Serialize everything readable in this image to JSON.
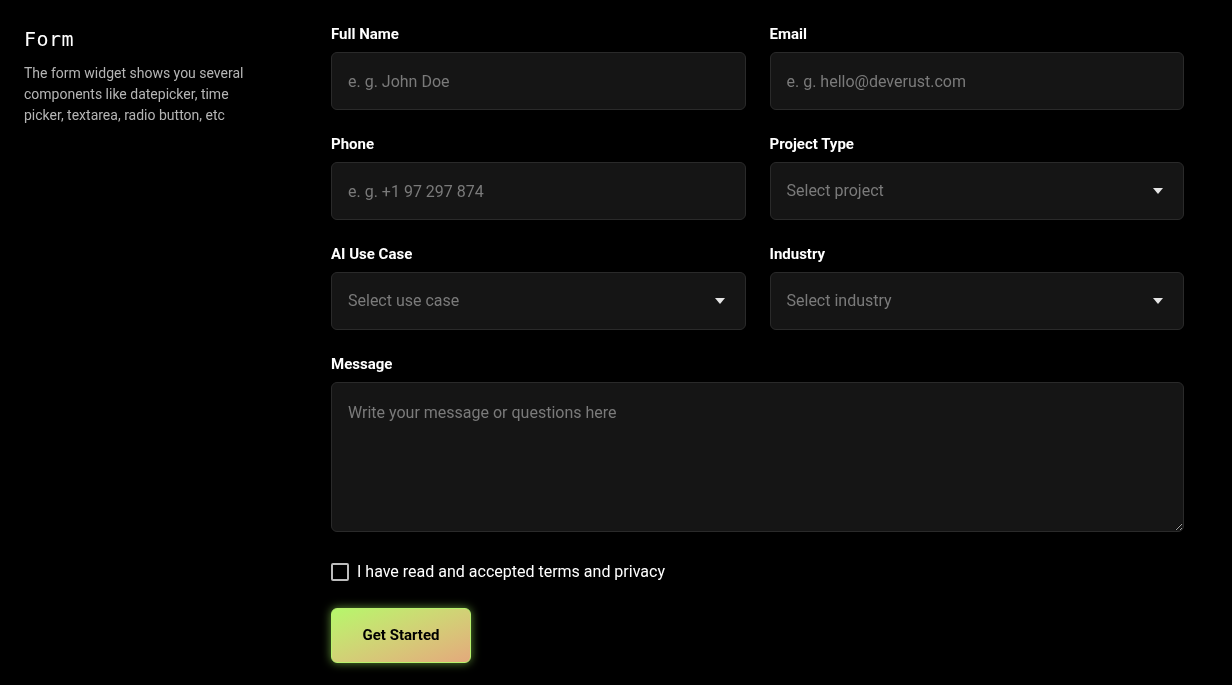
{
  "intro": {
    "title": "Form",
    "description": "The form widget shows you several components like datepicker, time picker, textarea, radio button, etc"
  },
  "fields": [
    {
      "kind": "text",
      "label": "Full Name",
      "placeholder": "e. g. John Doe"
    },
    {
      "kind": "text",
      "label": "Email",
      "placeholder": "e. g. hello@deverust.com"
    },
    {
      "kind": "text",
      "label": "Phone",
      "placeholder": "e. g. +1 97 297 874"
    },
    {
      "kind": "select",
      "label": "Project Type",
      "placeholder": "Select project"
    },
    {
      "kind": "select",
      "label": "AI Use Case",
      "placeholder": "Select use case"
    },
    {
      "kind": "select",
      "label": "Industry",
      "placeholder": "Select industry"
    }
  ],
  "message": {
    "label": "Message",
    "placeholder": "Write your message or questions here"
  },
  "terms": {
    "label": "I have read and accepted terms and privacy",
    "checked": false
  },
  "submit": "Get Started"
}
